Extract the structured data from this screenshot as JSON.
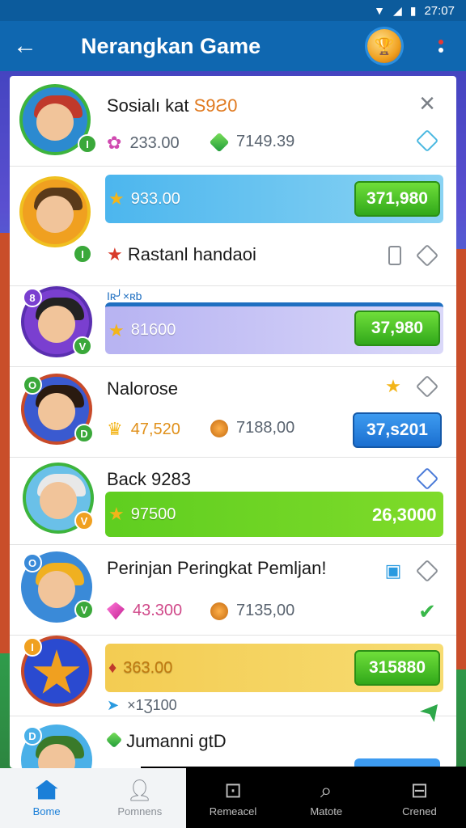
{
  "status_bar": {
    "time": "27:07",
    "wifi_icon": "wifi-icon",
    "signal_icon": "signal-icon",
    "battery_icon": "battery-icon"
  },
  "app_bar": {
    "title": "Nerangkan Game",
    "back_icon": "arrow-left-icon",
    "trophy_icon": "trophy-icon",
    "more_icon": "more-vertical-icon"
  },
  "rows": [
    {
      "name": "Sosialı kat",
      "name_highlight": "S9Ƨ0",
      "stat1": "233.00",
      "stat2": "7149.39",
      "badge": "I"
    },
    {
      "bar_value": "933.00",
      "button_value": "371,980",
      "badge": "I",
      "name": "Rastanl handaoi"
    },
    {
      "bar_value": "81600",
      "button_value": "37,980",
      "badge": "V",
      "top_badge": "8",
      "overlap_text": "Iʀ╯×ʀb"
    },
    {
      "name": "Nalorose",
      "stat1": "47,520",
      "stat2": "7188,00",
      "button_value": "37,s201",
      "badge": "D",
      "top_badge": "O"
    },
    {
      "name": "Back 9283",
      "bar_value": "97500",
      "score_value": "26,3000",
      "badge": "V"
    },
    {
      "name": "Perinjan Peringkat Pemljan!",
      "stat1": "43.300",
      "stat2": "7135,00",
      "badge": "V",
      "top_badge": "O"
    },
    {
      "bar_value": "363.00",
      "button_value": "315880",
      "stat1": "×1Ʒ100",
      "badge": "",
      "top_badge": "I"
    },
    {
      "name": "Jumanni gtD",
      "badge": "",
      "top_badge": "D"
    }
  ],
  "bottom_nav": [
    {
      "label": "Bome",
      "icon": "home-icon"
    },
    {
      "label": "Pomnens",
      "icon": "user-icon"
    },
    {
      "label": "Remeacel",
      "icon": "gamepad-icon"
    },
    {
      "label": "Matote",
      "icon": "search-icon"
    },
    {
      "label": "Crened",
      "icon": "settings-icon"
    }
  ],
  "colors": {
    "app_bar": "#0f67b0",
    "accent_green": "#3aa83a",
    "accent_blue": "#1b7fd8",
    "highlight_orange": "#e07a20"
  }
}
